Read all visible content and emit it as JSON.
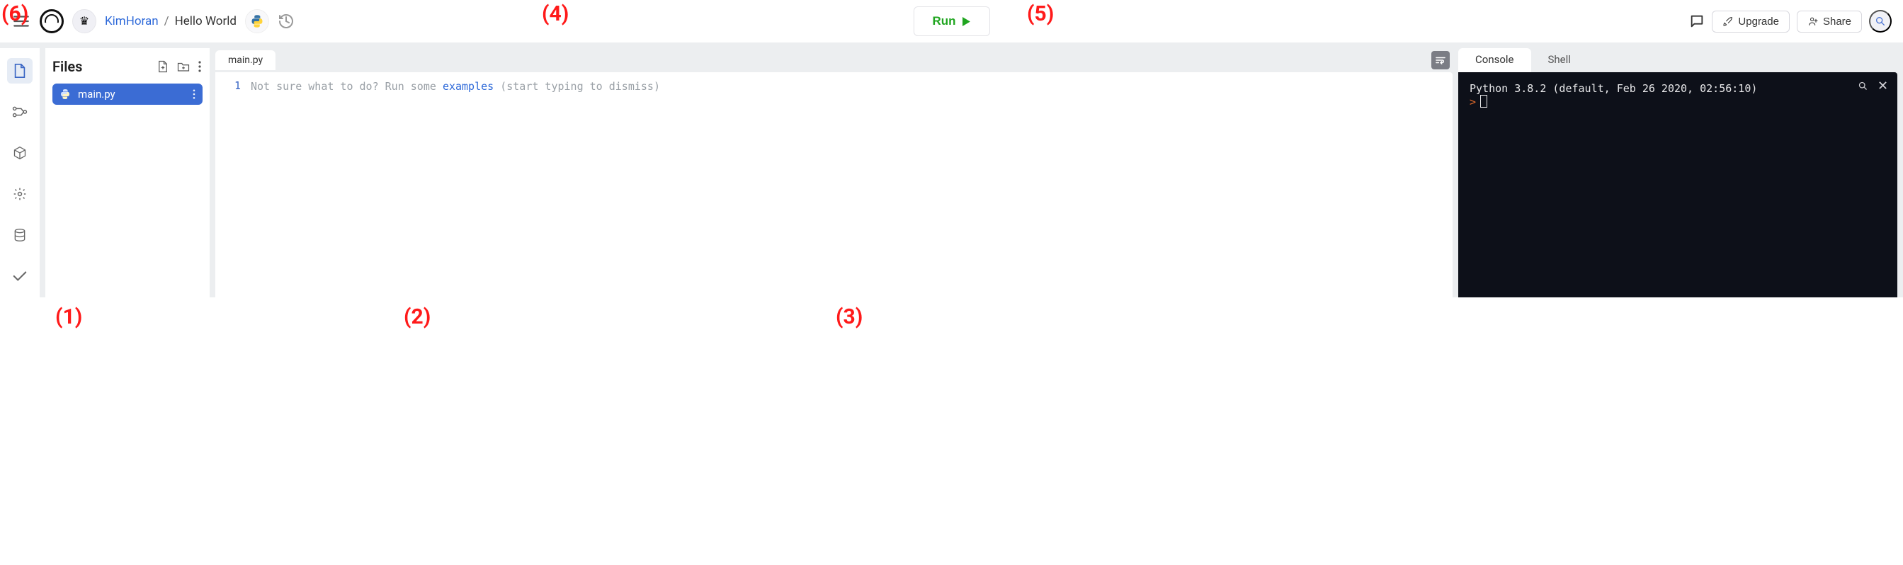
{
  "header": {
    "user": "KimHoran",
    "separator": "/",
    "project": "Hello World",
    "run_label": "Run",
    "upgrade_label": "Upgrade",
    "share_label": "Share"
  },
  "files_panel": {
    "title": "Files",
    "items": [
      {
        "name": "main.py"
      }
    ]
  },
  "editor": {
    "tab_label": "main.py",
    "line_numbers": [
      "1"
    ],
    "placeholder_pre": "Not sure what to do? Run some ",
    "placeholder_link": "examples",
    "placeholder_post": " (start typing to dismiss)"
  },
  "console": {
    "tabs": {
      "console": "Console",
      "shell": "Shell"
    },
    "banner": "Python 3.8.2 (default, Feb 26 2020, 02:56:10)",
    "prompt": ">"
  },
  "annotations": {
    "a1": "(1)",
    "a2": "(2)",
    "a3": "(3)",
    "a4": "(4)",
    "a5": "(5)",
    "a6": "(6)"
  }
}
